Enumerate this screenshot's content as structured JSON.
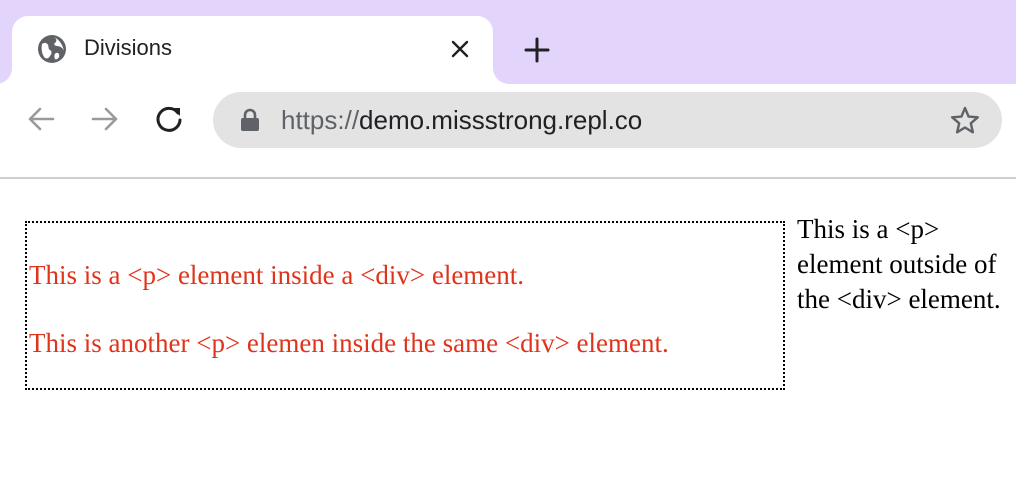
{
  "browser": {
    "tab": {
      "title": "Divisions",
      "favicon_icon": "globe-icon"
    },
    "new_tab_icon": "plus-icon",
    "close_icon": "close-icon",
    "toolbar": {
      "back_icon": "arrow-left-icon",
      "forward_icon": "arrow-right-icon",
      "reload_icon": "reload-icon",
      "lock_icon": "lock-icon",
      "bookmark_icon": "star-icon"
    },
    "address": {
      "scheme": "https://",
      "host": "demo.missstrong.repl.co"
    },
    "colors": {
      "tabstrip_bg": "#e3d4fb",
      "omnibox_bg": "#e3e3e3"
    }
  },
  "page": {
    "div": {
      "paragraphs": [
        "This is a <p> element inside a <div> element.",
        "This is another <p> elemen inside the same <div> element."
      ],
      "text_color": "#e0331b",
      "border_style": "dotted"
    },
    "outside_paragraph": "This is a <p> element outside of the <div> element."
  }
}
